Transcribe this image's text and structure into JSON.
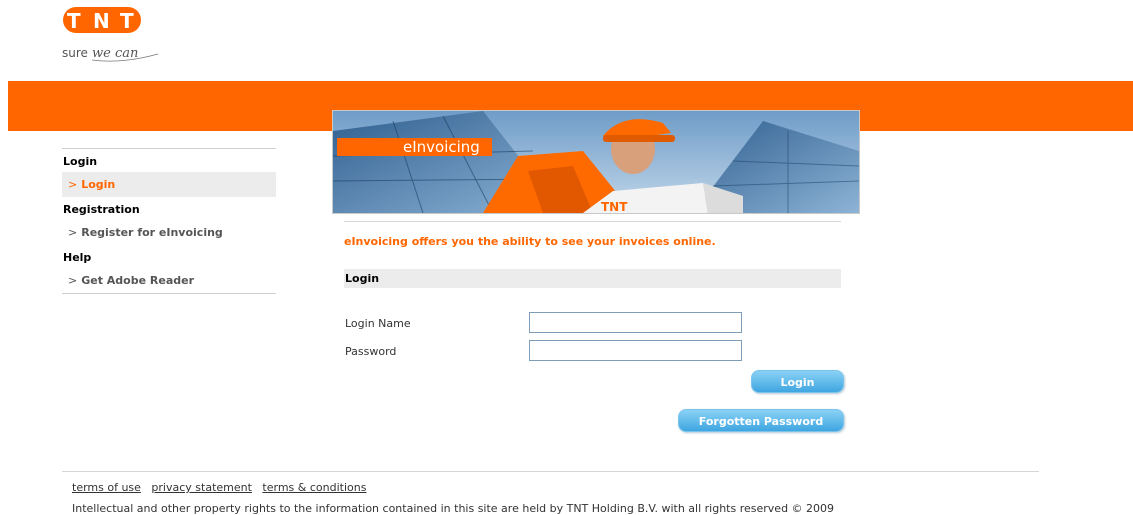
{
  "brand": {
    "logo_letters": "TNT",
    "slogan": "sure we can",
    "orange": "#ff6600",
    "blue_button": "#3fa6e1"
  },
  "hero": {
    "label": "eInvoicing",
    "image": "tnt-courier-with-package"
  },
  "nav": {
    "sections": [
      {
        "title": "Login",
        "items": [
          {
            "label": "Login",
            "active": true
          }
        ]
      },
      {
        "title": "Registration",
        "items": [
          {
            "label": "Register for eInvoicing",
            "active": false
          }
        ]
      },
      {
        "title": "Help",
        "items": [
          {
            "label": "Get Adobe Reader",
            "active": false
          }
        ]
      }
    ]
  },
  "main": {
    "tagline": "eInvoicing offers you the ability to see your invoices online.",
    "section_title": "Login",
    "login_name_label": "Login Name",
    "login_name_value": "",
    "password_label": "Password",
    "password_value": "",
    "login_button": "Login",
    "forgotten_button": "Forgotten Password"
  },
  "footer": {
    "links": [
      "terms of use",
      "privacy statement",
      "terms & conditions"
    ],
    "copyright": "Intellectual and other property rights to the information contained in this site are held by TNT Holding B.V. with all rights reserved © 2009"
  }
}
